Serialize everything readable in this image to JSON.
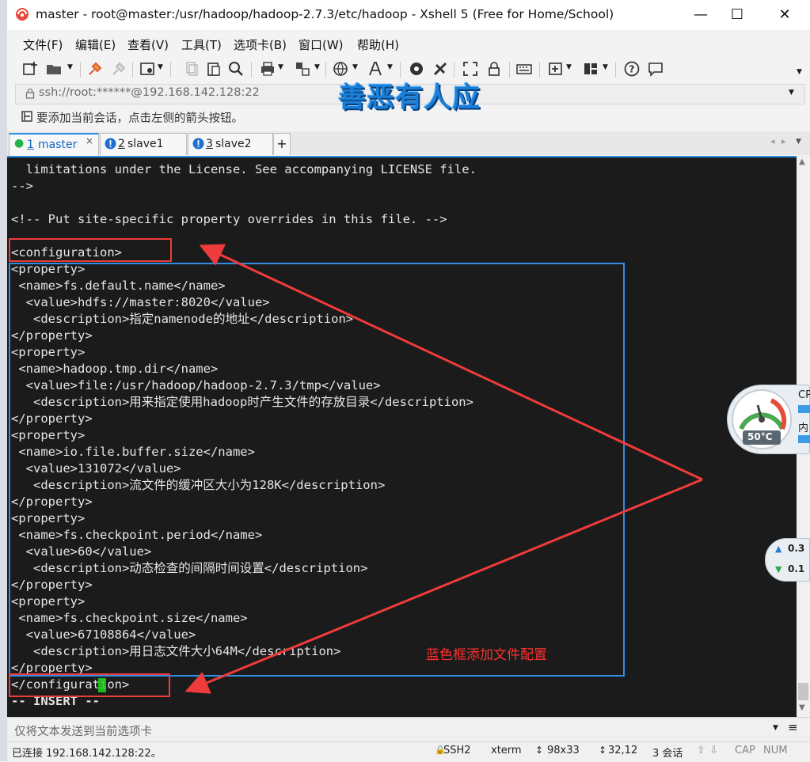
{
  "window": {
    "title": "master - root@master:/usr/hadoop/hadoop-2.7.3/etc/hadoop - Xshell 5 (Free for Home/School)",
    "controls": {
      "minimize": "—",
      "maximize": "☐",
      "close": "✕"
    }
  },
  "menu": [
    "文件(F)",
    "编辑(E)",
    "查看(V)",
    "工具(T)",
    "选项卡(B)",
    "窗口(W)",
    "帮助(H)"
  ],
  "address": {
    "value": "ssh://root:******@192.168.142.128:22"
  },
  "watermark": "善恶有人应",
  "hint": "要添加当前会话，点击左侧的箭头按钮。",
  "tabs": [
    {
      "label": "1 master",
      "number": "1",
      "name": "master",
      "active": true
    },
    {
      "label": "2 slave1",
      "number": "2",
      "name": "slave1",
      "active": false
    },
    {
      "label": "3 slave2",
      "number": "3",
      "name": "slave2",
      "active": false
    }
  ],
  "tab_add": "+",
  "terminal": {
    "lines": [
      "  limitations under the License. See accompanying LICENSE file.",
      "-->",
      "",
      "<!-- Put site-specific property overrides in this file. -->",
      "",
      "<configuration>",
      "<property>",
      " <name>fs.default.name</name>",
      "  <value>hdfs://master:8020</value>",
      "   <description>指定namenode的地址</description>",
      "</property>",
      "<property>",
      " <name>hadoop.tmp.dir</name>",
      "  <value>file:/usr/hadoop/hadoop-2.7.3/tmp</value>",
      "   <description>用来指定使用hadoop时产生文件的存放目录</description>",
      "</property>",
      "<property>",
      " <name>io.file.buffer.size</name>",
      "  <value>131072</value>",
      "   <description>流文件的缓冲区大小为128K</description>",
      "</property>",
      "<property>",
      " <name>fs.checkpoint.period</name>",
      "  <value>60</value>",
      "   <description>动态检查的间隔时间设置</description>",
      "</property>",
      "<property>",
      " <name>fs.checkpoint.size</name>",
      "  <value>67108864</value>",
      "   <description>用日志文件大小64M</description>",
      "</property>",
      "</configuration>",
      "-- INSERT --"
    ]
  },
  "annotation": "蓝色框添加文件配置",
  "input_placeholder": "仅将文本发送到当前选项卡",
  "status": {
    "connection": "已连接 192.168.142.128:22。",
    "protocol": "SSH2",
    "terminal_type": "xterm",
    "size": "98x33",
    "cursor": "32,12",
    "sessions": "3 会话",
    "caps": "CAP",
    "num": "NUM"
  },
  "widgets": {
    "temperature": "50°C",
    "cpu_label": "CP",
    "mem_label": "内",
    "net_up": "0.3",
    "net_down": "0.1"
  },
  "colors": {
    "accent": "#2f8fe4",
    "annotation_red": "#ef3b3b",
    "terminal_bg": "#1b1b1b",
    "cursor": "#23d21f"
  }
}
